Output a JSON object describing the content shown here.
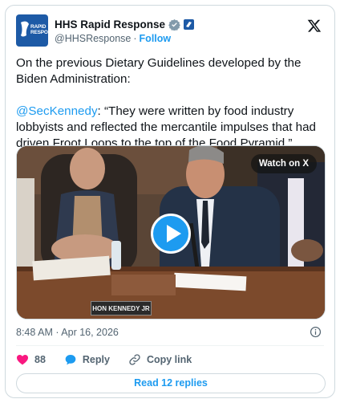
{
  "account": {
    "display_name": "HHS Rapid Response",
    "handle": "@HHSResponse",
    "separator": "·",
    "follow_label": "Follow",
    "avatar_text": "RAPID RESPONSE"
  },
  "tweet": {
    "paragraph1": "On the previous Dietary Guidelines developed by the Biden Administration:",
    "mention": "@SecKennedy",
    "quote": ": “They were written by food industry lobbyists and reflected the mercantile impulses that had driven Froot Loops to the top of the Food Pyramid.”"
  },
  "media": {
    "watch_label": "Watch on X",
    "nameplate_text": "HON KENNEDY JR"
  },
  "timestamp": "8:48 AM · Apr 16, 2026",
  "actions": {
    "like_count": "88",
    "reply_label": "Reply",
    "copy_label": "Copy link"
  },
  "replies_button": "Read 12 replies",
  "colors": {
    "accent": "#1d9bf0",
    "like": "#f91880",
    "text": "#0f1419",
    "muted": "#536471"
  }
}
